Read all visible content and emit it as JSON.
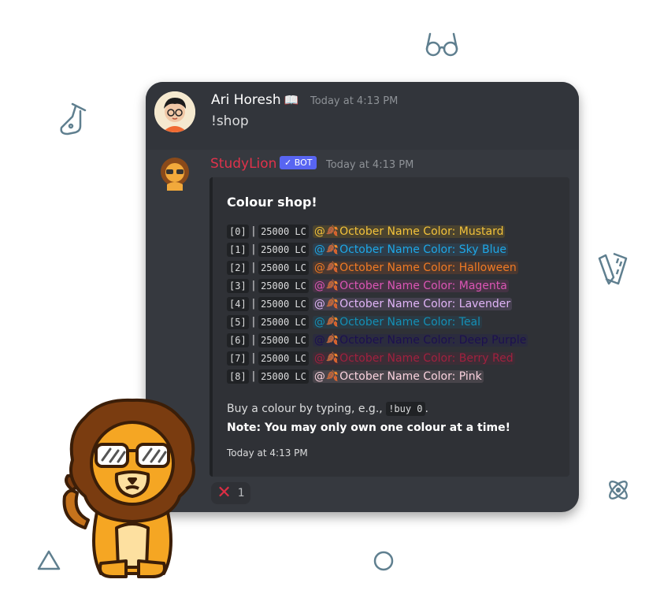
{
  "message1": {
    "author": "Ari Horesh",
    "author_badge_icon": "book-icon",
    "timestamp": "Today at 4:13 PM",
    "text": "!shop"
  },
  "message2": {
    "author": "StudyLion",
    "author_color": "#e0324b",
    "bot_badge": "✓ BOT",
    "timestamp": "Today at 4:13 PM",
    "embed": {
      "title": "Colour shop!",
      "rows": [
        {
          "index": "[0]",
          "price": "25000 LC",
          "role": "October Name Color: Mustard",
          "color": "#f2c23b",
          "bg": "#4a432f"
        },
        {
          "index": "[1]",
          "price": "25000 LC",
          "role": "October Name Color: Sky Blue",
          "color": "#1ea7e6",
          "bg": "#2e3d4a"
        },
        {
          "index": "[2]",
          "price": "25000 LC",
          "role": "October Name Color: Halloween",
          "color": "#f07a24",
          "bg": "#4a3830"
        },
        {
          "index": "[3]",
          "price": "25000 LC",
          "role": "October Name Color: Magenta",
          "color": "#db55b4",
          "bg": "#453344"
        },
        {
          "index": "[4]",
          "price": "25000 LC",
          "role": "October Name Color: Lavender",
          "color": "#e0b4f7",
          "bg": "#45404f"
        },
        {
          "index": "[5]",
          "price": "25000 LC",
          "role": "October Name Color: Teal",
          "color": "#148fb5",
          "bg": "#2a3a44"
        },
        {
          "index": "[6]",
          "price": "25000 LC",
          "role": "October Name Color: Deep Purple",
          "color": "#1c1050",
          "bg": "#2b2c3e"
        },
        {
          "index": "[7]",
          "price": "25000 LC",
          "role": "October Name Color: Berry Red",
          "color": "#a0213f",
          "bg": "#3c2d36"
        },
        {
          "index": "[8]",
          "price": "25000 LC",
          "role": "October Name Color: Pink",
          "color": "#fad2de",
          "bg": "#48444a"
        }
      ],
      "footer_prefix": "Buy a colour by typing, e.g.,",
      "footer_code": "!buy 0",
      "footer_suffix": ".",
      "note": "Note: You may only own one colour at a time!",
      "timestamp": "Today at 4:13 PM"
    },
    "reaction": {
      "emoji": "✕",
      "count": "1"
    }
  }
}
